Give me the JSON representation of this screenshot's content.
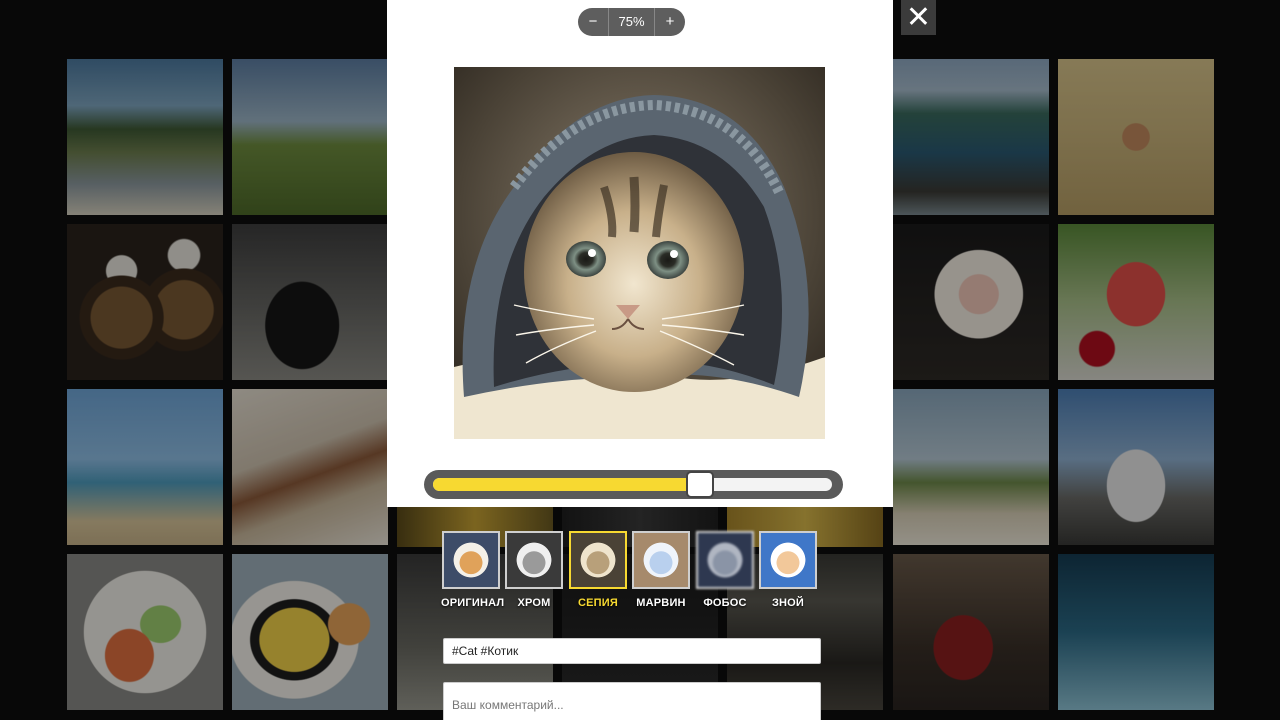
{
  "zoom": {
    "minus_label": "−",
    "value": "75%",
    "plus_label": "+"
  },
  "close_label": "✕",
  "slider": {
    "value_percent": 67
  },
  "filters": [
    {
      "label": "ОРИГИНАЛ",
      "active": false
    },
    {
      "label": "ХРОМ",
      "active": false
    },
    {
      "label": "СЕПИЯ",
      "active": true
    },
    {
      "label": "МАРВИН",
      "active": false
    },
    {
      "label": "ФОБОС",
      "active": false
    },
    {
      "label": "ЗНОЙ",
      "active": false
    }
  ],
  "tags": {
    "value": "#Cat #Котик"
  },
  "comment": {
    "placeholder": "Ваш комментарий...",
    "value": ""
  },
  "colors": {
    "accent": "#f7d931",
    "panel": "#ffffff",
    "control": "#5e5e5e"
  }
}
